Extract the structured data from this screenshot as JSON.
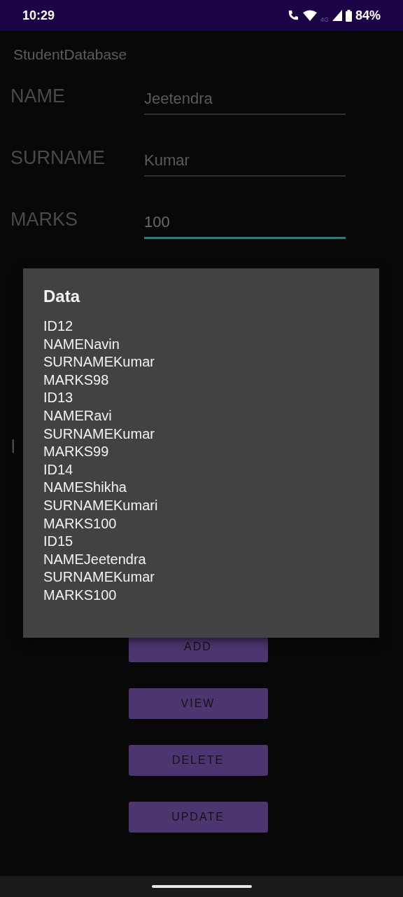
{
  "status_bar": {
    "time": "10:29",
    "network": "4G",
    "battery": "84%"
  },
  "app_bar": {
    "title": "StudentDatabase"
  },
  "form": [
    {
      "label": "NAME",
      "value": "Jeetendra",
      "focused": false
    },
    {
      "label": "SURNAME",
      "value": "Kumar",
      "focused": false
    },
    {
      "label": "MARKS",
      "value": "100",
      "focused": true
    },
    {
      "label": "I"
    }
  ],
  "buttons": [
    "ADD",
    "VIEW",
    "DELETE",
    "UPDATE"
  ],
  "dialog": {
    "title": "Data",
    "lines": [
      "ID12",
      "NAMENavin",
      "SURNAMEKumar",
      "MARKS98",
      "ID13",
      "NAMERavi",
      "SURNAMEKumar",
      "MARKS99",
      "ID14",
      "NAMEShikha",
      "SURNAMEKumari",
      "MARKS100",
      "ID15",
      "NAMEJeetendra",
      "SURNAMEKumar",
      "MARKS100"
    ]
  }
}
